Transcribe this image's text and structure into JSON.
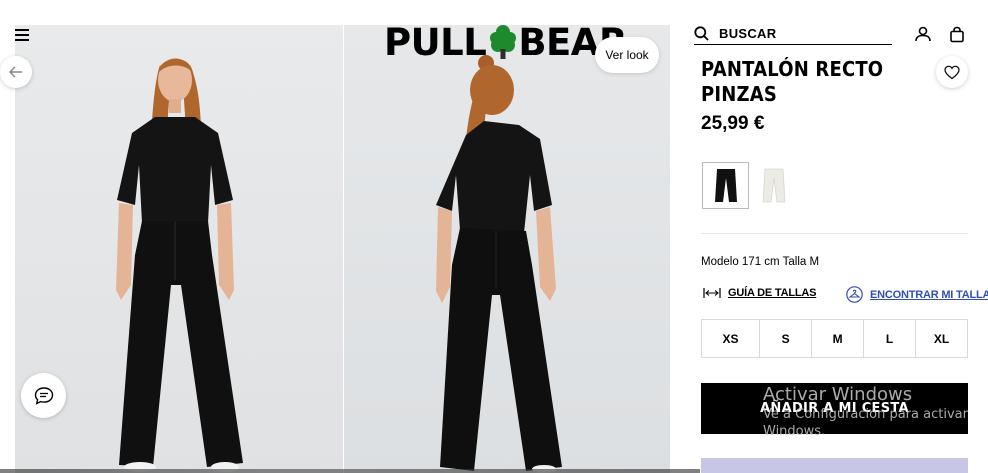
{
  "brand": {
    "logo_left": "PULL",
    "logo_right": "BEAR"
  },
  "gallery": {
    "ver_look": "Ver look"
  },
  "search": {
    "placeholder": "BUSCAR"
  },
  "product": {
    "name": "PANTALÓN RECTO PINZAS",
    "price": "25,99 €",
    "colors": [
      "black",
      "white"
    ],
    "model_info": "Modelo 171 cm Talla M",
    "size_guide": "GUÍA DE TALLAS",
    "find_size": "ENCONTRAR MI TALLA",
    "sizes": [
      "XS",
      "S",
      "M",
      "L",
      "XL"
    ],
    "add_to_cart": "AÑADIR A MI CESTA"
  },
  "watermark": {
    "title": "Activar Windows",
    "subtitle": "Ve a Configuración para activar\nWindows."
  },
  "colors": {
    "accent_blue": "#2f4fb3",
    "button_black": "#000000",
    "lavender": "#c7c6e6"
  }
}
